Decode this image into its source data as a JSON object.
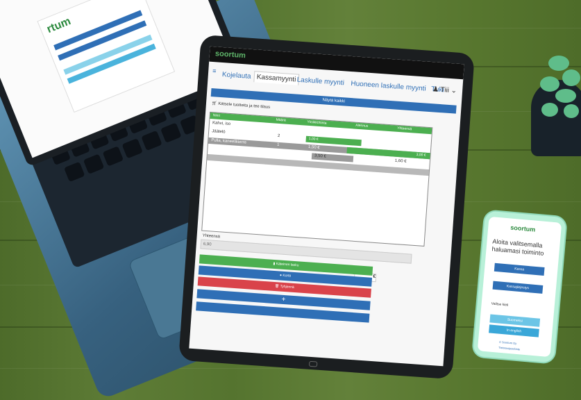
{
  "laptop": {
    "logo": "rtum"
  },
  "tablet": {
    "logo": "soortum",
    "tabs": [
      "Kojelauta",
      "Kassamyynti",
      "Laskulle myynti",
      "Huoneen laskulle myynti",
      "Tuki"
    ],
    "user": "Tiii",
    "section_header": "Näytä kaikki",
    "cart_title": "Kätsele tuotteita ja tee tilaus",
    "table_headers": [
      "Nimi",
      "Määrä",
      "Yksikköhinta",
      "Alennus",
      "Yhteensä"
    ],
    "rows": [
      {
        "name": "Kahvi, iso",
        "qty": "",
        "price": "",
        "total": ""
      },
      {
        "name": "Jäätelö",
        "qty": "2",
        "price": "1,00 €",
        "total": "3,00 €"
      },
      {
        "name": "Pulla, kaneelikierre",
        "qty": "1",
        "price": "1,50 €",
        "total": "1,60 €"
      }
    ],
    "subtotal": "3,50 €",
    "total_label": "Yhteensä",
    "total_value": "6,90",
    "euro_symbol": "€",
    "buttons": {
      "pay": "Käteinen lasku",
      "card": "Kortti",
      "cancel": "Tyhjennä"
    },
    "plus": "+"
  },
  "phone": {
    "logo": "soortum",
    "title": "Aloita valitsemalla haluamasi toiminto",
    "btn1": "Kassa",
    "btn2": "Kassajärjestys",
    "lang_label": "Valitse kieli",
    "lang1": "Suomeksi",
    "lang2": "In english",
    "footer1": "© Soortum Oy",
    "footer2": "Tietosuojaseloste"
  }
}
